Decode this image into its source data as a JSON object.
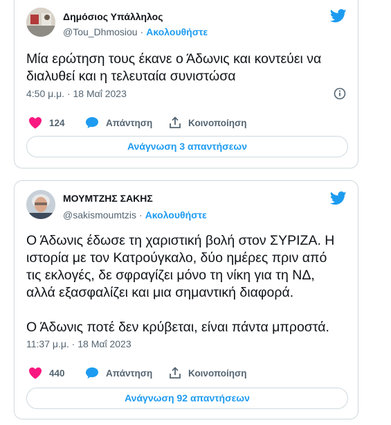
{
  "tweets": [
    {
      "author": "Δημόσιος Υπάλληλος",
      "handle": "@Tou_Dhmosiou",
      "separator": "·",
      "follow_label": "Ακολουθήστε",
      "text": "Μία ερώτηση τους έκανε ο Άδωνις και κοντεύει να\nδιαλυθεί και η τελευταία συνιστώσα",
      "timestamp": "4:50 μ.μ. · 18 Μαΐ 2023",
      "likes": "124",
      "reply_label": "Απάντηση",
      "share_label": "Κοινοποίηση",
      "read_replies_label": "Ανάγνωση 3 απαντήσεων"
    },
    {
      "author": "ΜΟΥΜΤΖΗΣ ΣΑΚΗΣ",
      "handle": "@sakismoumtzis",
      "separator": "·",
      "follow_label": "Ακολουθήστε",
      "text": "Ο Άδωνις έδωσε τη χαριστική βολή στον ΣΥΡΙΖΑ. Η\nιστορία με τον Κατρούγκαλο, δύο ημέρες πριν από\nτις εκλογές, δε σφραγίζει μόνο τη νίκη για τη ΝΔ,\nαλλά εξασφαλίζει και μια σημαντική διαφορά.\n\nΟ Άδωνις ποτέ δεν κρύβεται, είναι πάντα μπροστά.",
      "timestamp": "11:37 μ.μ. · 18 Μαΐ 2023",
      "likes": "440",
      "reply_label": "Απάντηση",
      "share_label": "Κοινοποίηση",
      "read_replies_label": "Ανάγνωση 92 απαντήσεων"
    }
  ],
  "colors": {
    "accent": "#1d9bf0",
    "like": "#f91880",
    "muted": "#536471",
    "border": "#cfd9de"
  },
  "icons": [
    "twitter-bird-icon",
    "heart-icon",
    "reply-bubble-icon",
    "share-icon",
    "info-icon"
  ]
}
